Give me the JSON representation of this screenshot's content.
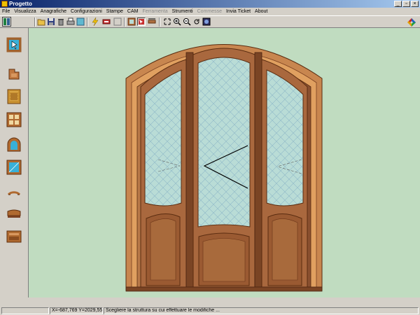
{
  "window": {
    "title": "Progetto",
    "controls": [
      "minimize",
      "restore",
      "close"
    ]
  },
  "menu": {
    "items": [
      {
        "label": "File",
        "enabled": true
      },
      {
        "label": "Visualizza",
        "enabled": true
      },
      {
        "label": "Anagrafiche",
        "enabled": true
      },
      {
        "label": "Configurazioni",
        "enabled": true
      },
      {
        "label": "Stampe",
        "enabled": true
      },
      {
        "label": "CAM",
        "enabled": true
      },
      {
        "label": "Ferramenta",
        "enabled": false
      },
      {
        "label": "Strumenti",
        "enabled": true
      },
      {
        "label": "Commesse",
        "enabled": false
      },
      {
        "label": "Invia Ticket",
        "enabled": true
      },
      {
        "label": "About",
        "enabled": true
      }
    ]
  },
  "toolbar": {
    "buttons": [
      "panel-toggle-icon",
      "open-folder-icon",
      "save-icon",
      "delete-icon",
      "print-icon",
      "copy-icon",
      "lightning-icon",
      "element-icon",
      "blank-icon",
      "frame-icon",
      "pointer-frame-icon",
      "measure-icon",
      "zoom-extents-icon",
      "zoom-in-icon",
      "zoom-out-icon",
      "rotate-icon",
      "render-icon"
    ],
    "pressed": "pointer-frame-icon"
  },
  "left_tools": [
    {
      "icon": "select-pointer-icon",
      "selected": true
    },
    {
      "icon": "profile-section-icon",
      "selected": false
    },
    {
      "icon": "texture-panel-icon",
      "selected": false
    },
    {
      "icon": "window-frame-icon",
      "selected": false
    },
    {
      "icon": "arch-window-icon",
      "selected": false
    },
    {
      "icon": "glass-panel-icon",
      "selected": false
    },
    {
      "icon": "arch-segment-icon",
      "selected": false
    },
    {
      "icon": "curved-rail-icon",
      "selected": false
    },
    {
      "icon": "door-panel-icon",
      "selected": false
    }
  ],
  "status": {
    "coords": "X=-687,769 Y=2029,558",
    "message": "Scegliere la struttura su cui effettuare le modifiche ..."
  },
  "colors": {
    "canvas_bg": "#c0dcc0",
    "wood": "#a0623e",
    "glass": "#b9dcd6",
    "titlebar": "#0a246a"
  }
}
